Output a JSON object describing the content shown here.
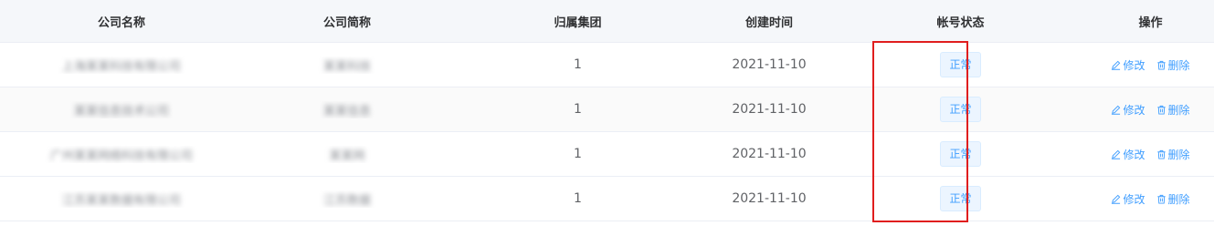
{
  "columns": {
    "company_name": "公司名称",
    "short_name": "公司简称",
    "group": "归属集团",
    "created_at": "创建时间",
    "account_status": "帐号状态",
    "actions": "操作"
  },
  "rows": [
    {
      "company_name": "上海某某科技有限公司",
      "short_name": "某某科技",
      "group": "1",
      "created_at": "2021-11-10",
      "status": "正常"
    },
    {
      "company_name": "某某信息技术公司",
      "short_name": "某某信息",
      "group": "1",
      "created_at": "2021-11-10",
      "status": "正常"
    },
    {
      "company_name": "广州某某网络科技有限公司",
      "short_name": "某某网",
      "group": "1",
      "created_at": "2021-11-10",
      "status": "正常"
    },
    {
      "company_name": "江苏某某数据有限公司",
      "short_name": "江苏数据",
      "group": "1",
      "created_at": "2021-11-10",
      "status": "正常"
    }
  ],
  "row_actions": {
    "edit": "修改",
    "delete": "删除"
  },
  "colors": {
    "accent": "#409eff",
    "highlight": "#e01e1e"
  }
}
